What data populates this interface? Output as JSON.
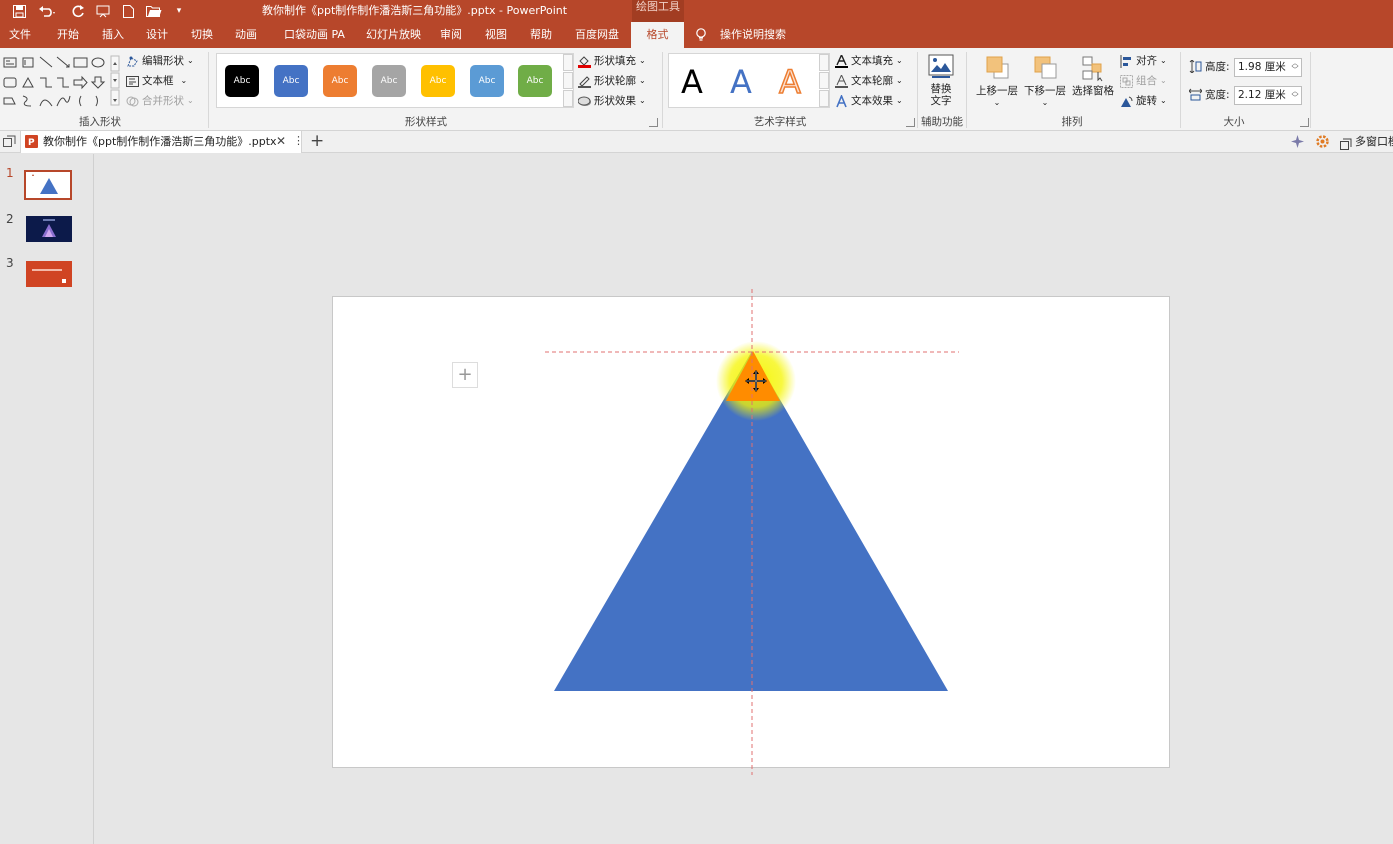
{
  "window": {
    "title": "教你制作《ppt制作制作潘浩斯三角功能》.pptx  -  PowerPoint",
    "contextual_tab_group": "绘图工具"
  },
  "tabs": [
    {
      "label": "文件"
    },
    {
      "label": "开始"
    },
    {
      "label": "插入"
    },
    {
      "label": "设计"
    },
    {
      "label": "切换"
    },
    {
      "label": "动画"
    },
    {
      "label": "口袋动画 PA"
    },
    {
      "label": "幻灯片放映"
    },
    {
      "label": "审阅"
    },
    {
      "label": "视图"
    },
    {
      "label": "帮助"
    },
    {
      "label": "百度网盘"
    },
    {
      "label": "格式"
    }
  ],
  "tell_me": "操作说明搜索",
  "ribbon": {
    "insert_shapes": {
      "label": "插入形状",
      "edit_shape": "编辑形状",
      "text_box": "文本框",
      "merge_shapes": "合并形状"
    },
    "shape_styles": {
      "label": "形状样式",
      "swatch_text": "Abc",
      "swatch_colors": [
        "#000000",
        "#4472c4",
        "#ed7d31",
        "#a5a5a5",
        "#ffc000",
        "#5b9bd5",
        "#70ad47"
      ],
      "fill": "形状填充",
      "outline": "形状轮廓",
      "effects": "形状效果"
    },
    "wordart_styles": {
      "label": "艺术字样式",
      "sample": "A",
      "text_fill": "文本填充",
      "text_outline": "文本轮廓",
      "text_effects": "文本效果"
    },
    "accessibility": {
      "label": "辅助功能",
      "alt_text_line1": "替换",
      "alt_text_line2": "文字"
    },
    "arrange": {
      "label": "排列",
      "bring_forward": "上移一层",
      "send_backward": "下移一层",
      "selection_pane": "选择窗格",
      "align": "对齐",
      "group": "组合",
      "rotate": "旋转"
    },
    "size": {
      "label": "大小",
      "height_label": "高度:",
      "height_value": "1.98 厘米",
      "width_label": "宽度:",
      "width_value": "2.12 厘米"
    }
  },
  "document_tab": {
    "name": "教你制作《ppt制作制作潘浩斯三角功能》.pptx",
    "multi_window": "多窗口模"
  },
  "slides": [
    {
      "number": "1"
    },
    {
      "number": "2"
    },
    {
      "number": "3"
    }
  ],
  "canvas": {
    "large_triangle_color": "#4472c4",
    "small_triangle_color": "#ff8c00",
    "glow_color": "#f5f500",
    "guide_color": "#e07070"
  }
}
